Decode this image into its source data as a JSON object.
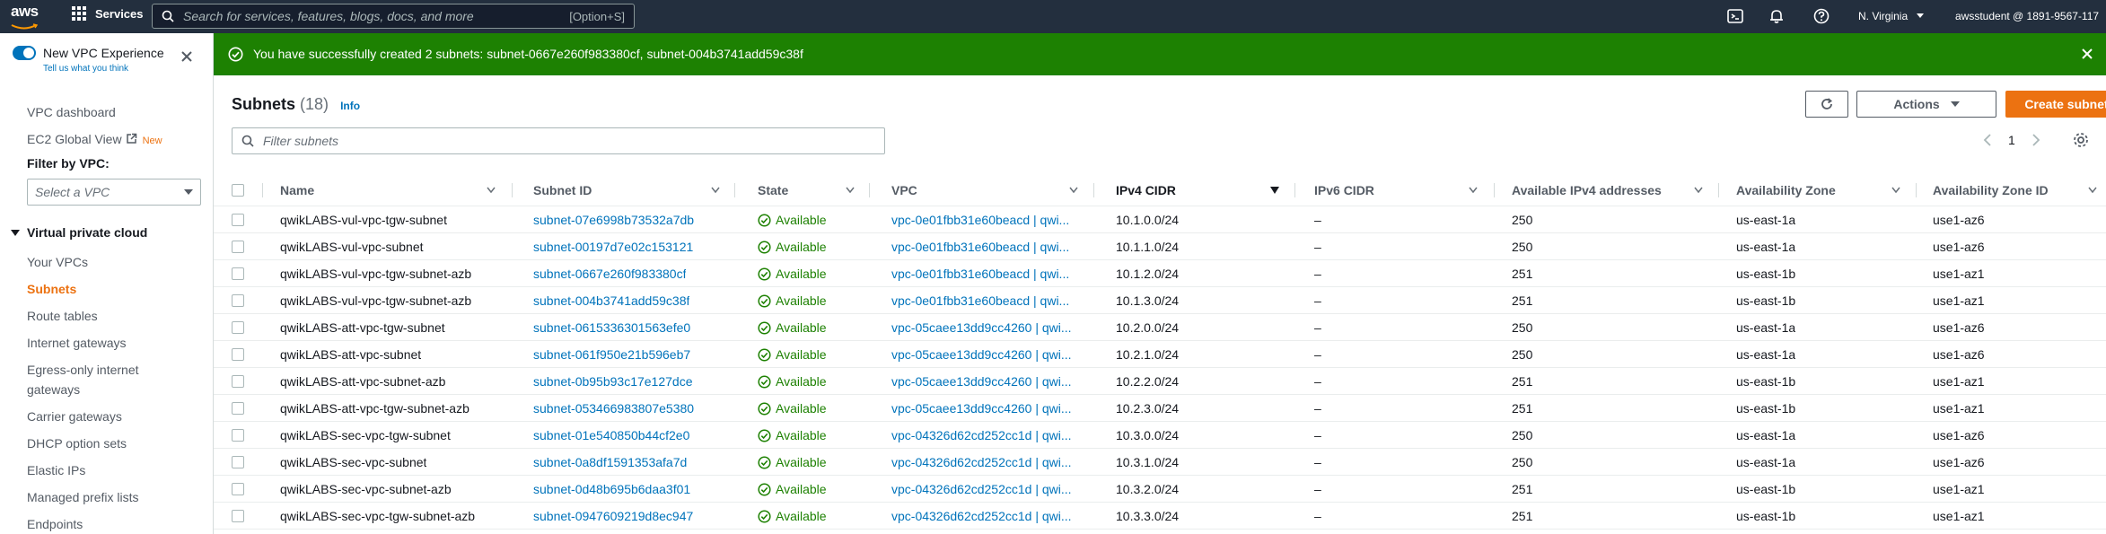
{
  "topnav": {
    "logo_text": "aws",
    "services_label": "Services",
    "search_placeholder": "Search for services, features, blogs, docs, and more",
    "search_shortcut": "[Option+S]",
    "region": "N. Virginia",
    "account": "awsstudent @ 1891-9567-117"
  },
  "sidebar": {
    "toggle_label": "New VPC Experience",
    "tell_us": "Tell us what you think",
    "vpc_dashboard": "VPC dashboard",
    "ec2_global_view": "EC2 Global View",
    "new_badge": "New",
    "filter_label": "Filter by VPC:",
    "filter_placeholder": "Select a VPC",
    "section_title": "Virtual private cloud",
    "items": [
      {
        "label": "Your VPCs"
      },
      {
        "label": "Subnets"
      },
      {
        "label": "Route tables"
      },
      {
        "label": "Internet gateways"
      },
      {
        "label": "Egress-only internet"
      },
      {
        "label": "gateways"
      },
      {
        "label": "Carrier gateways"
      },
      {
        "label": "DHCP option sets"
      },
      {
        "label": "Elastic IPs"
      },
      {
        "label": "Managed prefix lists"
      },
      {
        "label": "Endpoints"
      }
    ]
  },
  "flash": {
    "message": "You have successfully created 2 subnets: subnet-0667e260f983380cf, subnet-004b3741add59c38f"
  },
  "main": {
    "title": "Subnets",
    "count": "(18)",
    "info": "Info",
    "actions_label": "Actions",
    "create_label": "Create subnet",
    "filter_placeholder": "Filter subnets",
    "page": "1"
  },
  "columns": {
    "name": "Name",
    "subnet_id": "Subnet ID",
    "state": "State",
    "vpc": "VPC",
    "ipv4": "IPv4 CIDR",
    "ipv6": "IPv6 CIDR",
    "avail": "Available IPv4 addresses",
    "az": "Availability Zone",
    "azid": "Availability Zone ID"
  },
  "rows": [
    {
      "name": "qwikLABS-vul-vpc-tgw-subnet",
      "id": "subnet-07e6998b73532a7db",
      "state": "Available",
      "vpc": "vpc-0e01fbb31e60beacd | qwi...",
      "ipv4": "10.1.0.0/24",
      "ipv6": "–",
      "avail": "250",
      "az": "us-east-1a",
      "azid": "use1-az6"
    },
    {
      "name": "qwikLABS-vul-vpc-subnet",
      "id": "subnet-00197d7e02c153121",
      "state": "Available",
      "vpc": "vpc-0e01fbb31e60beacd | qwi...",
      "ipv4": "10.1.1.0/24",
      "ipv6": "–",
      "avail": "250",
      "az": "us-east-1a",
      "azid": "use1-az6"
    },
    {
      "name": "qwikLABS-vul-vpc-tgw-subnet-azb",
      "id": "subnet-0667e260f983380cf",
      "state": "Available",
      "vpc": "vpc-0e01fbb31e60beacd | qwi...",
      "ipv4": "10.1.2.0/24",
      "ipv6": "–",
      "avail": "251",
      "az": "us-east-1b",
      "azid": "use1-az1"
    },
    {
      "name": "qwikLABS-vul-vpc-tgw-subnet-azb",
      "id": "subnet-004b3741add59c38f",
      "state": "Available",
      "vpc": "vpc-0e01fbb31e60beacd | qwi...",
      "ipv4": "10.1.3.0/24",
      "ipv6": "–",
      "avail": "251",
      "az": "us-east-1b",
      "azid": "use1-az1"
    },
    {
      "name": "qwikLABS-att-vpc-tgw-subnet",
      "id": "subnet-0615336301563efe0",
      "state": "Available",
      "vpc": "vpc-05caee13dd9cc4260 | qwi...",
      "ipv4": "10.2.0.0/24",
      "ipv6": "–",
      "avail": "250",
      "az": "us-east-1a",
      "azid": "use1-az6"
    },
    {
      "name": "qwikLABS-att-vpc-subnet",
      "id": "subnet-061f950e21b596eb7",
      "state": "Available",
      "vpc": "vpc-05caee13dd9cc4260 | qwi...",
      "ipv4": "10.2.1.0/24",
      "ipv6": "–",
      "avail": "250",
      "az": "us-east-1a",
      "azid": "use1-az6"
    },
    {
      "name": "qwikLABS-att-vpc-subnet-azb",
      "id": "subnet-0b95b93c17e127dce",
      "state": "Available",
      "vpc": "vpc-05caee13dd9cc4260 | qwi...",
      "ipv4": "10.2.2.0/24",
      "ipv6": "–",
      "avail": "251",
      "az": "us-east-1b",
      "azid": "use1-az1"
    },
    {
      "name": "qwikLABS-att-vpc-tgw-subnet-azb",
      "id": "subnet-053466983807e5380",
      "state": "Available",
      "vpc": "vpc-05caee13dd9cc4260 | qwi...",
      "ipv4": "10.2.3.0/24",
      "ipv6": "–",
      "avail": "251",
      "az": "us-east-1b",
      "azid": "use1-az1"
    },
    {
      "name": "qwikLABS-sec-vpc-tgw-subnet",
      "id": "subnet-01e540850b44cf2e0",
      "state": "Available",
      "vpc": "vpc-04326d62cd252cc1d | qwi...",
      "ipv4": "10.3.0.0/24",
      "ipv6": "–",
      "avail": "250",
      "az": "us-east-1a",
      "azid": "use1-az6"
    },
    {
      "name": "qwikLABS-sec-vpc-subnet",
      "id": "subnet-0a8df1591353afa7d",
      "state": "Available",
      "vpc": "vpc-04326d62cd252cc1d | qwi...",
      "ipv4": "10.3.1.0/24",
      "ipv6": "–",
      "avail": "250",
      "az": "us-east-1a",
      "azid": "use1-az6"
    },
    {
      "name": "qwikLABS-sec-vpc-subnet-azb",
      "id": "subnet-0d48b695b6daa3f01",
      "state": "Available",
      "vpc": "vpc-04326d62cd252cc1d | qwi...",
      "ipv4": "10.3.2.0/24",
      "ipv6": "–",
      "avail": "251",
      "az": "us-east-1b",
      "azid": "use1-az1"
    },
    {
      "name": "qwikLABS-sec-vpc-tgw-subnet-azb",
      "id": "subnet-0947609219d8ec947",
      "state": "Available",
      "vpc": "vpc-04326d62cd252cc1d | qwi...",
      "ipv4": "10.3.3.0/24",
      "ipv6": "–",
      "avail": "251",
      "az": "us-east-1b",
      "azid": "use1-az1"
    }
  ],
  "colors": {
    "nav_bg": "#232f3e",
    "success": "#1d8102",
    "accent": "#ec7211",
    "link": "#0073bb"
  }
}
